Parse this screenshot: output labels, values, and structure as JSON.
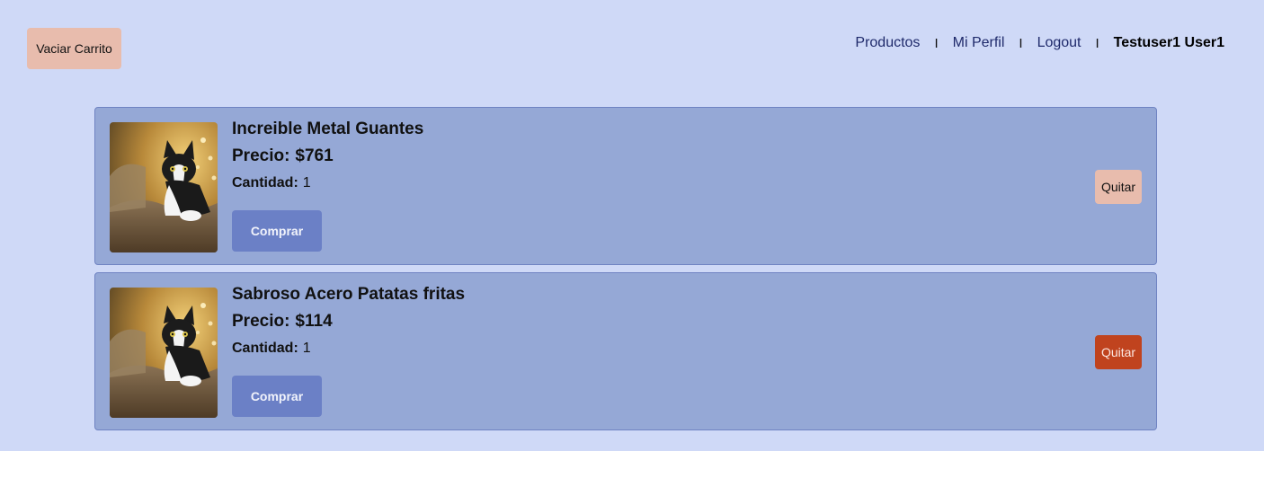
{
  "toolbar": {
    "empty_cart_label": "Vaciar Carrito"
  },
  "nav": {
    "products": "Productos",
    "separator": "I",
    "profile": "Mi Perfil",
    "logout": "Logout",
    "user_name": "Testuser1 User1"
  },
  "cart": {
    "items": [
      {
        "name": "Increible Metal Guantes",
        "price_label": "Precio:",
        "price": "$761",
        "quantity_label": "Cantidad:",
        "quantity": "1",
        "buy_label": "Comprar",
        "remove_label": "Quitar",
        "image_alt": "cat-photo"
      },
      {
        "name": "Sabroso Acero Patatas fritas",
        "price_label": "Precio:",
        "price": "$114",
        "quantity_label": "Cantidad:",
        "quantity": "1",
        "buy_label": "Comprar",
        "remove_label": "Quitar",
        "image_alt": "cat-photo"
      }
    ]
  },
  "colors": {
    "page_background": "#cfd9f7",
    "card_background": "#95a8d6",
    "buy_button": "#6b80c6",
    "remove_button_default": "#e8bcad",
    "remove_button_hover": "#c0431e"
  }
}
